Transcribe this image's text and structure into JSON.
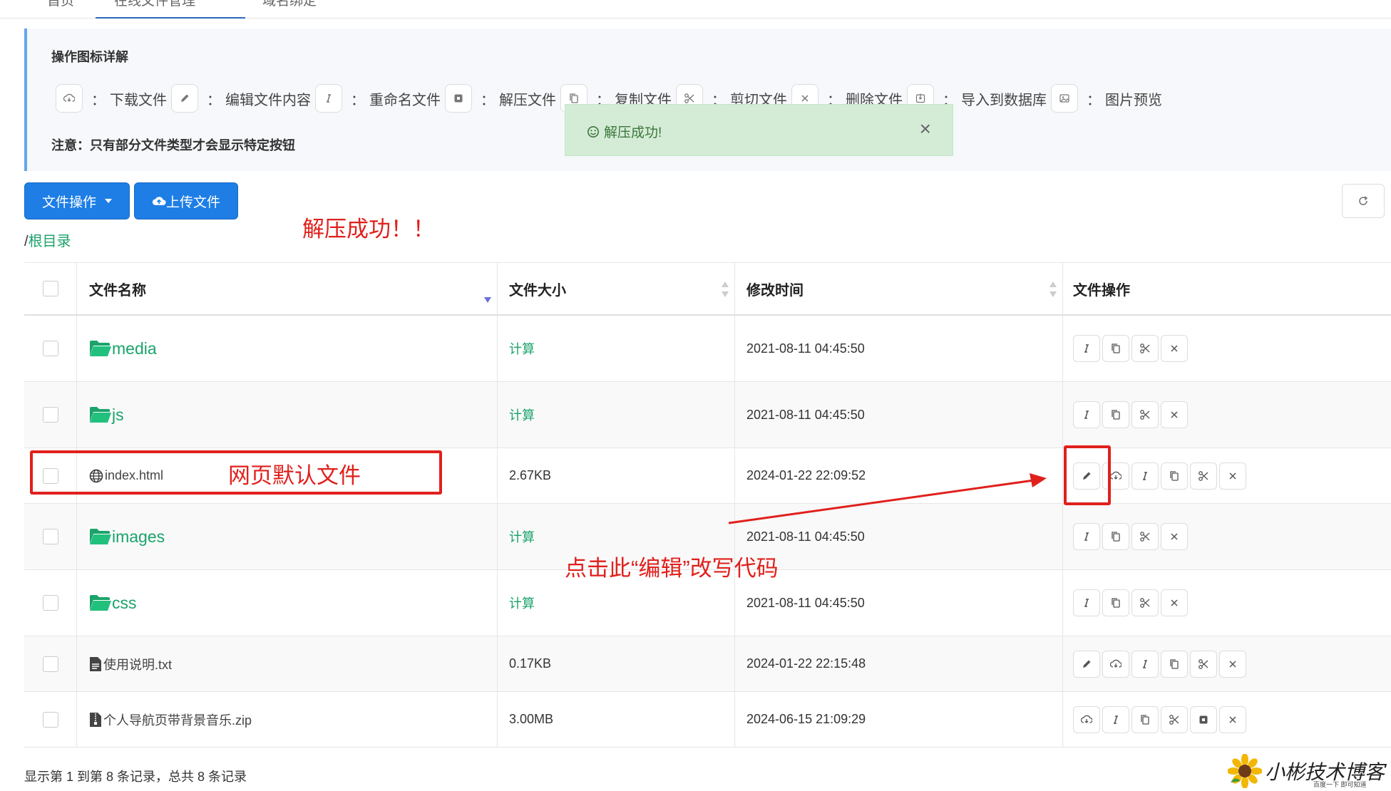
{
  "tabs": [
    {
      "label": "首页"
    },
    {
      "label": "在线文件管理"
    },
    {
      "label": "域名绑定"
    }
  ],
  "info": {
    "title": "操作图标详解",
    "legend": [
      {
        "icon": "download-icon",
        "label": "下载文件"
      },
      {
        "icon": "pencil-icon",
        "label": "编辑文件内容"
      },
      {
        "icon": "rename-icon",
        "label": "重命名文件"
      },
      {
        "icon": "unzip-icon",
        "label": "解压文件"
      },
      {
        "icon": "copy-icon",
        "label": "复制文件"
      },
      {
        "icon": "scissors-icon",
        "label": "剪切文件"
      },
      {
        "icon": "close-icon",
        "label": "删除文件"
      },
      {
        "icon": "import-icon",
        "label": "导入到数据库"
      },
      {
        "icon": "image-preview-icon",
        "label": "图片预览"
      }
    ],
    "colon": "：",
    "note": "注意：只有部分文件类型才会显示特定按钮"
  },
  "toast": {
    "text": "解压成功!",
    "close": "×"
  },
  "toolbar": {
    "file_ops_label": "文件操作",
    "upload_label": "上传文件"
  },
  "breadcrumb": {
    "sep": "/",
    "root": "根目录"
  },
  "annotations": {
    "unzip_success": "解压成功！！",
    "default_file": "网页默认文件",
    "edit_hint": "点击此“编辑”改写代码"
  },
  "table": {
    "headers": {
      "name": "文件名称",
      "size": "文件大小",
      "mtime": "修改时间",
      "ops": "文件操作"
    },
    "rows": [
      {
        "name": "media",
        "type": "folder",
        "size": "计算",
        "mtime": "2021-08-11 04:45:50",
        "ops": [
          "rename-icon",
          "copy-icon",
          "scissors-icon",
          "close-icon"
        ]
      },
      {
        "name": "js",
        "type": "folder",
        "size": "计算",
        "mtime": "2021-08-11 04:45:50",
        "ops": [
          "rename-icon",
          "copy-icon",
          "scissors-icon",
          "close-icon"
        ]
      },
      {
        "name": "index.html",
        "type": "html",
        "size": "2.67KB",
        "mtime": "2024-01-22 22:09:52",
        "ops": [
          "pencil-icon",
          "download-icon",
          "rename-icon",
          "copy-icon",
          "scissors-icon",
          "close-icon"
        ]
      },
      {
        "name": "images",
        "type": "folder",
        "size": "计算",
        "mtime": "2021-08-11 04:45:50",
        "ops": [
          "rename-icon",
          "copy-icon",
          "scissors-icon",
          "close-icon"
        ]
      },
      {
        "name": "css",
        "type": "folder",
        "size": "计算",
        "mtime": "2021-08-11 04:45:50",
        "ops": [
          "rename-icon",
          "copy-icon",
          "scissors-icon",
          "close-icon"
        ]
      },
      {
        "name": "使用说明.txt",
        "type": "txt",
        "size": "0.17KB",
        "mtime": "2024-01-22 22:15:48",
        "ops": [
          "pencil-icon",
          "download-icon",
          "rename-icon",
          "copy-icon",
          "scissors-icon",
          "close-icon"
        ]
      },
      {
        "name": "个人导航页带背景音乐.zip",
        "type": "zip",
        "size": "3.00MB",
        "mtime": "2024-06-15 21:09:29",
        "ops": [
          "download-icon",
          "rename-icon",
          "copy-icon",
          "scissors-icon",
          "unzip-icon",
          "close-icon"
        ]
      }
    ]
  },
  "footer": {
    "text": "显示第 1 到第 8 条记录，总共 8 条记录"
  },
  "watermark": {
    "title": "小彬技术博客",
    "subtitle": "百度一下 即可知道"
  },
  "colors": {
    "primary": "#1e7ee6",
    "green": "#1ba36b",
    "red_annotation": "#e0201c",
    "toast_bg": "#d4ecd5"
  }
}
